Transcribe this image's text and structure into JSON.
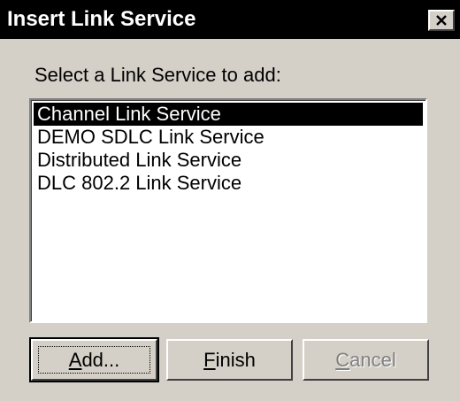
{
  "window": {
    "title": "Insert Link Service"
  },
  "prompt": "Select a Link Service to add:",
  "list": {
    "items": [
      {
        "label": "Channel Link Service",
        "selected": true
      },
      {
        "label": "DEMO SDLC Link Service",
        "selected": false
      },
      {
        "label": "Distributed Link Service",
        "selected": false
      },
      {
        "label": "DLC 802.2 Link Service",
        "selected": false
      }
    ]
  },
  "buttons": {
    "add": {
      "mnemonic": "A",
      "rest": "dd..."
    },
    "finish": {
      "mnemonic": "F",
      "rest": "inish"
    },
    "cancel": {
      "mnemonic": "C",
      "rest": "ancel"
    }
  },
  "icons": {
    "close": "close-icon"
  },
  "colors": {
    "face": "#d4d0c8",
    "titlebar": "#000000",
    "selection": "#000000"
  }
}
